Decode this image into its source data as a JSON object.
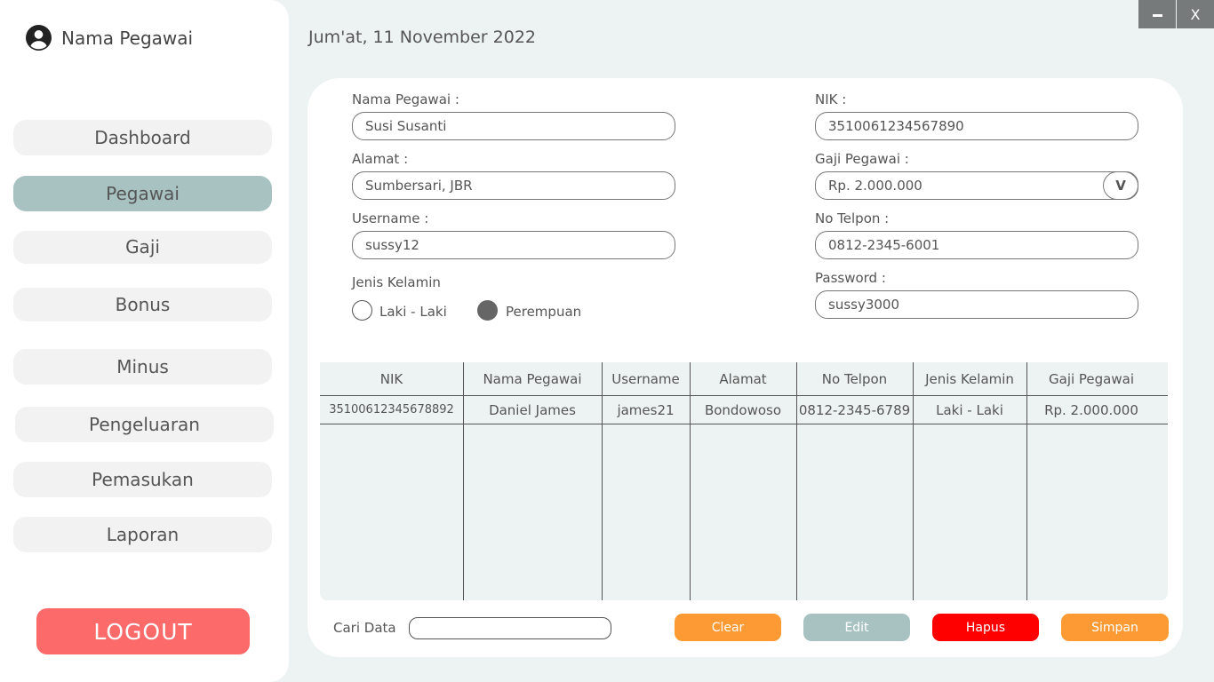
{
  "user": {
    "name": "Nama Pegawai",
    "icon": "user-circle-icon"
  },
  "date": "Jum'at, 11 November 2022",
  "window": {
    "minimize": "–",
    "close": "X"
  },
  "nav": [
    {
      "label": "Dashboard"
    },
    {
      "label": "Pegawai",
      "active": true
    },
    {
      "label": "Gaji"
    },
    {
      "label": "Bonus"
    },
    {
      "label": "Minus"
    },
    {
      "label": "Pengeluaran"
    },
    {
      "label": "Pemasukan"
    },
    {
      "label": "Laporan"
    }
  ],
  "logout": "LOGOUT",
  "form": {
    "nama_label": "Nama Pegawai :",
    "nama_value": "Susi Susanti",
    "alamat_label": "Alamat :",
    "alamat_value": "Sumbersari, JBR",
    "username_label": "Username :",
    "username_value": "sussy12",
    "gender_label": "Jenis Kelamin",
    "gender_options": [
      "Laki - Laki",
      "Perempuan"
    ],
    "gender_selected": "Perempuan",
    "nik_label": "NIK :",
    "nik_value": "3510061234567890",
    "gaji_label": "Gaji Pegawai :",
    "gaji_value": "Rp. 2.000.000",
    "gaji_dropdown": "V",
    "telpon_label": "No Telpon :",
    "telpon_value": "0812-2345-6001",
    "password_label": "Password :",
    "password_value": "sussy3000"
  },
  "table": {
    "headers": [
      "NIK",
      "Nama Pegawai",
      "Username",
      "Alamat",
      "No Telpon",
      "Jenis Kelamin",
      "Gaji Pegawai"
    ],
    "rows": [
      [
        "35100612345678892",
        "Daniel James",
        "james21",
        "Bondowoso",
        "0812-2345-6789",
        "Laki - Laki",
        "Rp. 2.000.000"
      ]
    ]
  },
  "search": {
    "label": "Cari Data",
    "value": ""
  },
  "actions": {
    "clear": "Clear",
    "edit": "Edit",
    "hapus": "Hapus",
    "simpan": "Simpan"
  },
  "colors": {
    "background": "#edf3f2",
    "nav_active": "#a8c2c2",
    "logout": "#fc6a6a",
    "clear": "#fd9a33",
    "edit": "#a8c2c2",
    "hapus": "#fe0000",
    "simpan": "#fd9a33"
  }
}
